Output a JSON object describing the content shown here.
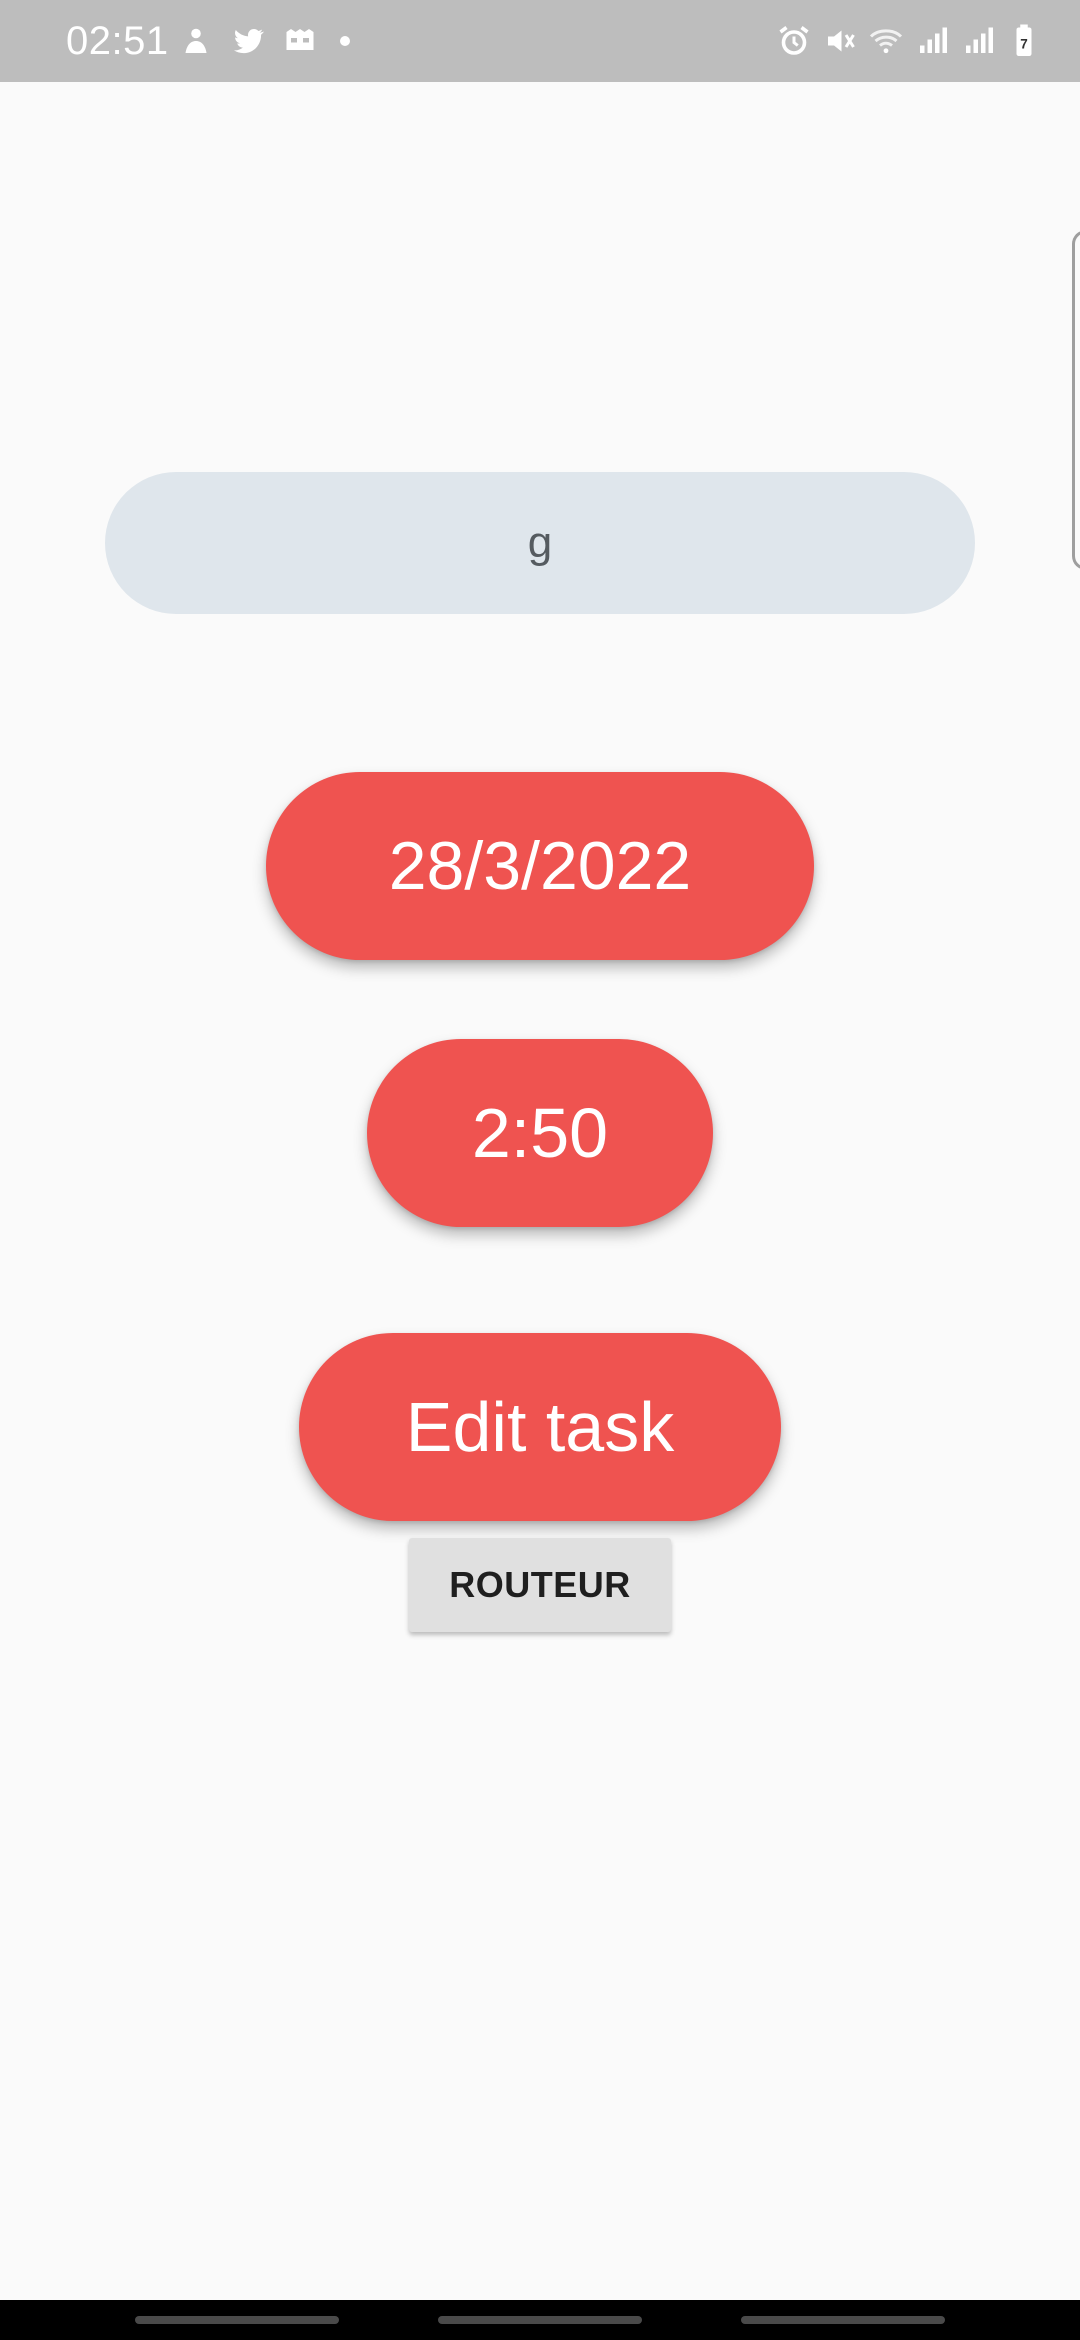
{
  "status_bar": {
    "time": "02:51",
    "left_icons": [
      "notification-app-icon",
      "twitter-icon",
      "game-icon",
      "more-dot-icon"
    ],
    "right_icons": [
      "alarm-icon",
      "vibrate-mute-icon",
      "wifi-icon",
      "signal-icon",
      "signal-icon",
      "battery-icon"
    ],
    "battery_level": "7"
  },
  "form": {
    "task_title_value": "g"
  },
  "buttons": {
    "date_label": "28/3/2022",
    "time_label": "2:50",
    "edit_label": "Edit task",
    "router_label": "ROUTEUR"
  },
  "colors": {
    "accent": "#ef5350",
    "field_bg": "#dfe6ec",
    "background": "#fafafa",
    "status_bar": "#bdbdbd"
  }
}
